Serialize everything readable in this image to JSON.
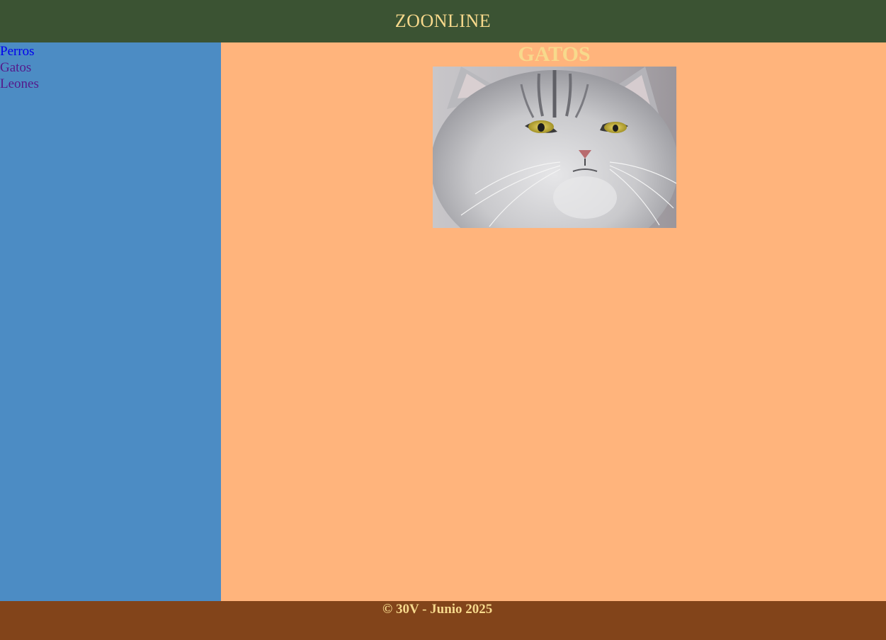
{
  "header": {
    "title": "ZOONLINE"
  },
  "sidebar": {
    "links": [
      {
        "label": "Perros",
        "state": "unvisited"
      },
      {
        "label": "Gatos",
        "state": "visited"
      },
      {
        "label": "Leones",
        "state": "visited"
      }
    ]
  },
  "main": {
    "heading": "GATOS"
  },
  "footer": {
    "text": "© 30V - Junio 2025"
  },
  "colors": {
    "header_bg": "#3b5333",
    "sidebar_bg": "#4c8cc4",
    "main_bg": "#ffb47c",
    "footer_bg": "#82441a",
    "accent_text": "#f7d98c",
    "link_unvisited": "#0000ee",
    "link_visited": "#551a8b"
  }
}
